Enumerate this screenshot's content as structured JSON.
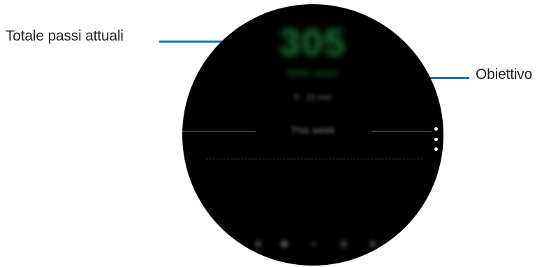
{
  "callouts": {
    "current_steps": "Totale passi attuali",
    "goal": "Obiettivo"
  },
  "screen": {
    "steps_count": "305",
    "goal_text": "6000 steps",
    "duration_text": "0 : 10 min",
    "period_label": "This week",
    "more_options_icon": "more-vertical-icon"
  },
  "colors": {
    "callout_line": "#0e78b8",
    "steps_green": "#1f7a35",
    "watch_bg": "#000000"
  }
}
